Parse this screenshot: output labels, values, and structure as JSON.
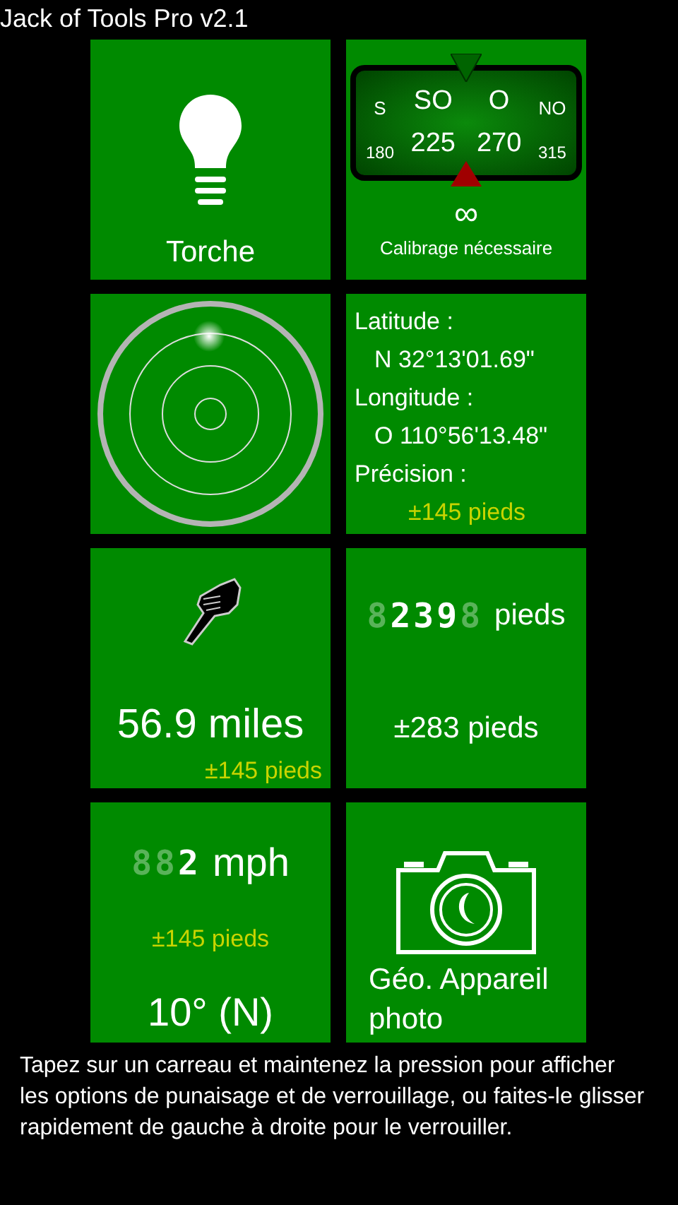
{
  "app_title": "Jack of Tools Pro v2.1",
  "tiles": [
    {
      "kind": "torch",
      "label": "Torche"
    },
    {
      "kind": "compass",
      "headings": [
        "S",
        "SO",
        "O",
        "NO"
      ],
      "degrees": [
        "180",
        "225",
        "270",
        "315"
      ],
      "value": "∞",
      "status": "Calibrage nécessaire"
    },
    {
      "kind": "level"
    },
    {
      "kind": "coordinates",
      "lines": [
        {
          "text": "Latitude :",
          "indent": false
        },
        {
          "text": "N 32°13'01.69\"",
          "indent": true
        },
        {
          "text": "Longitude :",
          "indent": false
        },
        {
          "text": "O 110°56'13.48\"",
          "indent": true
        },
        {
          "text": "Précision :",
          "indent": false
        }
      ],
      "accuracy": "±145 pieds"
    },
    {
      "kind": "distance",
      "value": "56.9 miles",
      "accuracy": "±145 pieds"
    },
    {
      "kind": "altitude",
      "digits": [
        {
          "text": "8",
          "lit": false
        },
        {
          "text": "2",
          "lit": true
        },
        {
          "text": "3",
          "lit": true
        },
        {
          "text": "9",
          "lit": true
        },
        {
          "text": "8",
          "lit": false
        }
      ],
      "unit": "pieds",
      "accuracy": "±283 pieds"
    },
    {
      "kind": "speed",
      "digits": [
        {
          "text": "8",
          "lit": false
        },
        {
          "text": "8",
          "lit": false
        },
        {
          "text": "2",
          "lit": true
        }
      ],
      "unit": "mph",
      "accuracy": "±145 pieds",
      "heading": "10° (N)"
    },
    {
      "kind": "camera",
      "label": "Géo. Appareil photo"
    }
  ],
  "hint": "Tapez sur un carreau et maintenez la pression pour afficher les options de punaisage et de verrouillage, ou faites-le glisser rapidement de gauche à droite pour le verrouiller."
}
